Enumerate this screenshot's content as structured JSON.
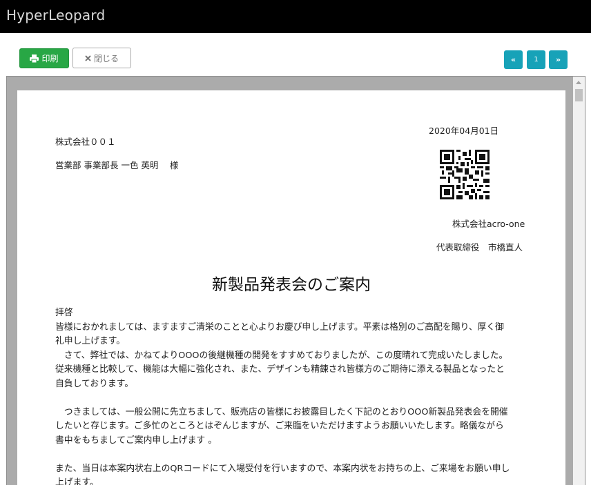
{
  "app": {
    "title": "HyperLeopard"
  },
  "toolbar": {
    "print_label": "印刷",
    "close_label": "閉じる",
    "print_icon": "printer-icon",
    "close_icon": "close-icon"
  },
  "pagination": {
    "first": "«",
    "current": "1",
    "last": "»"
  },
  "document": {
    "date": "2020年04月01日",
    "recipient_company": "株式会社００１",
    "recipient_person": "営業部 事業部長 一色 英明　 様",
    "sender_company": "株式会社acro-one",
    "sender_person": "代表取締役　市橋直人",
    "title": "新製品発表会のご案内",
    "greeting": "拝啓",
    "paragraph1_line1": "皆様におかれましては、ますますご清栄のことと心よりお慶び申し上げます。平素は格別のご高配を賜り、厚く御",
    "paragraph1_line2": "礼申し上げます。",
    "paragraph2_line1": "　さて、弊社では、かねてよりOOOの後継機種の開発をすすめておりましたが、この度晴れて完成いたしました。",
    "paragraph2_line2": "従来機種と比較して、機能は大幅に強化され、また、デザインも精錬され皆様方のご期待に添える製品となったと",
    "paragraph2_line3": "自負しております。",
    "paragraph3_line1": "　つきましては、一般公開に先立ちまして、販売店の皆様にお披露目したく下記のとおりOOO新製品発表会を開催",
    "paragraph3_line2": "したいと存じます。ご多忙のところとはぞんじますが、ご来臨をいただけますようお願いいたします。略儀ながら",
    "paragraph3_line3": "書中をもちましてご案内申し上げます 。",
    "paragraph4_line1": "また、当日は本案内状右上のQRコードにて入場受付を行いますので、本案内状をお持ちの上、ご来場をお願い申し",
    "paragraph4_line2": "上げます。"
  },
  "colors": {
    "topbar": "#000000",
    "print_button": "#28a745",
    "pagination": "#17a2b8",
    "viewer_bg": "#ababab"
  }
}
